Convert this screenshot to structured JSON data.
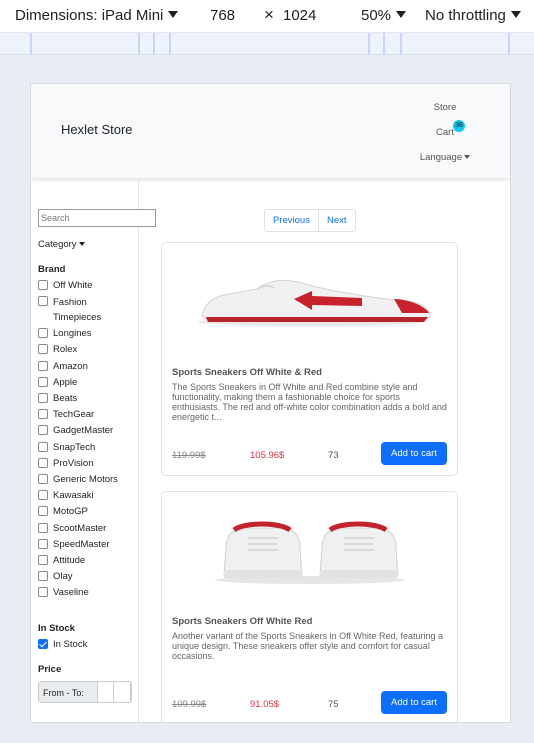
{
  "devtools": {
    "dimensions_label": "Dimensions: iPad Mini",
    "width": "768",
    "times": "×",
    "height": "1024",
    "zoom": "50%",
    "throttling": "No throttling"
  },
  "navbar": {
    "brand": "Hexlet Store",
    "store_link": "Store",
    "cart_link": "Cart",
    "cart_count": "36",
    "language": "Language"
  },
  "sidebar": {
    "search_placeholder": "Search",
    "category_label": "Category",
    "brand_title": "Brand",
    "brands": [
      {
        "label": "Off White",
        "checked": false
      },
      {
        "label": "Fashion Timepieces",
        "checked": false
      },
      {
        "label": "Longines",
        "checked": false
      },
      {
        "label": "Rolex",
        "checked": false
      },
      {
        "label": "Amazon",
        "checked": false
      },
      {
        "label": "Apple",
        "checked": false
      },
      {
        "label": "Beats",
        "checked": false
      },
      {
        "label": "TechGear",
        "checked": false
      },
      {
        "label": "GadgetMaster",
        "checked": false
      },
      {
        "label": "SnapTech",
        "checked": false
      },
      {
        "label": "ProVision",
        "checked": false
      },
      {
        "label": "Generic Motors",
        "checked": false
      },
      {
        "label": "Kawasaki",
        "checked": false
      },
      {
        "label": "MotoGP",
        "checked": false
      },
      {
        "label": "ScootMaster",
        "checked": false
      },
      {
        "label": "SpeedMaster",
        "checked": false
      },
      {
        "label": "Attitude",
        "checked": false
      },
      {
        "label": "Olay",
        "checked": false
      },
      {
        "label": "Vaseline",
        "checked": false
      }
    ],
    "instock_title": "In Stock",
    "instock_label": "In Stock",
    "instock_checked": true,
    "price_title": "Price",
    "price_range_label": "From - To:"
  },
  "pagination": {
    "previous": "Previous",
    "next": "Next"
  },
  "products": [
    {
      "title": "Sports Sneakers Off White & Red",
      "description": "The Sports Sneakers in Off White and Red combine style and functionality, making them a fashionable choice for sports enthusiasts. The red and off-white color combination adds a bold and energetic t...",
      "old_price": "119.99$",
      "price": "105.96$",
      "stock": "73",
      "button": "Add to cart"
    },
    {
      "title": "Sports Sneakers Off White Red",
      "description": "Another variant of the Sports Sneakers in Off White Red, featuring a unique design. These sneakers offer style and comfort for casual occasions.",
      "old_price": "109.99$",
      "price": "91.05$",
      "stock": "75",
      "button": "Add to cart"
    }
  ],
  "colors": {
    "primary": "#0d6efd",
    "sale_price": "#dc3545",
    "badge": "#0dcaf0"
  }
}
